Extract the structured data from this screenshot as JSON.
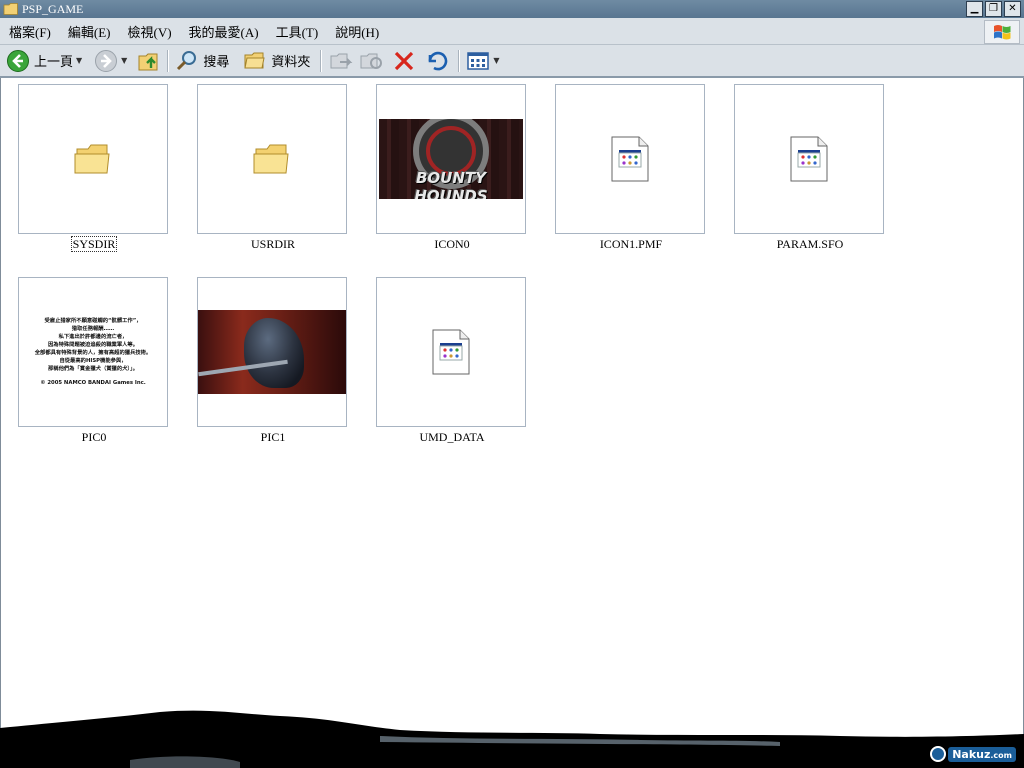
{
  "window": {
    "title": "PSP_GAME"
  },
  "menu": [
    {
      "label": "檔案(F)"
    },
    {
      "label": "編輯(E)"
    },
    {
      "label": "檢視(V)"
    },
    {
      "label": "我的最愛(A)"
    },
    {
      "label": "工具(T)"
    },
    {
      "label": "說明(H)"
    }
  ],
  "toolbar": {
    "back_label": "上一頁",
    "search_label": "搜尋",
    "folders_label": "資料夾"
  },
  "files": [
    {
      "name": "SYSDIR",
      "type": "folder",
      "selected": true
    },
    {
      "name": "USRDIR",
      "type": "folder"
    },
    {
      "name": "ICON0",
      "type": "image"
    },
    {
      "name": "ICON1.PMF",
      "type": "document"
    },
    {
      "name": "PARAM.SFO",
      "type": "document"
    },
    {
      "name": "PIC0",
      "type": "image"
    },
    {
      "name": "PIC1",
      "type": "image"
    },
    {
      "name": "UMD_DATA",
      "type": "document"
    }
  ],
  "thumbs": {
    "icon0_logo": "BOUNTY HOUNDS",
    "pic0_lines": [
      "受雇止猎家所不願意碰觸的“骯髒工作”，",
      "猎取任務報酬……",
      "私下進出於許都邊的流亡者，",
      "因為特殊問題被迫追殺的職業軍人等。",
      "全部都具有特殊背景的人，擁有高超的獵兵技術。",
      "自從最高的HISP機能參與，",
      "那稱他們為「賞金獵犬（賞獵的犬）」。"
    ],
    "pic0_copyright": "© 2005 NAMCO BANDAI Games Inc."
  },
  "watermark": {
    "text": "Nakuz",
    "sub": ".com"
  }
}
